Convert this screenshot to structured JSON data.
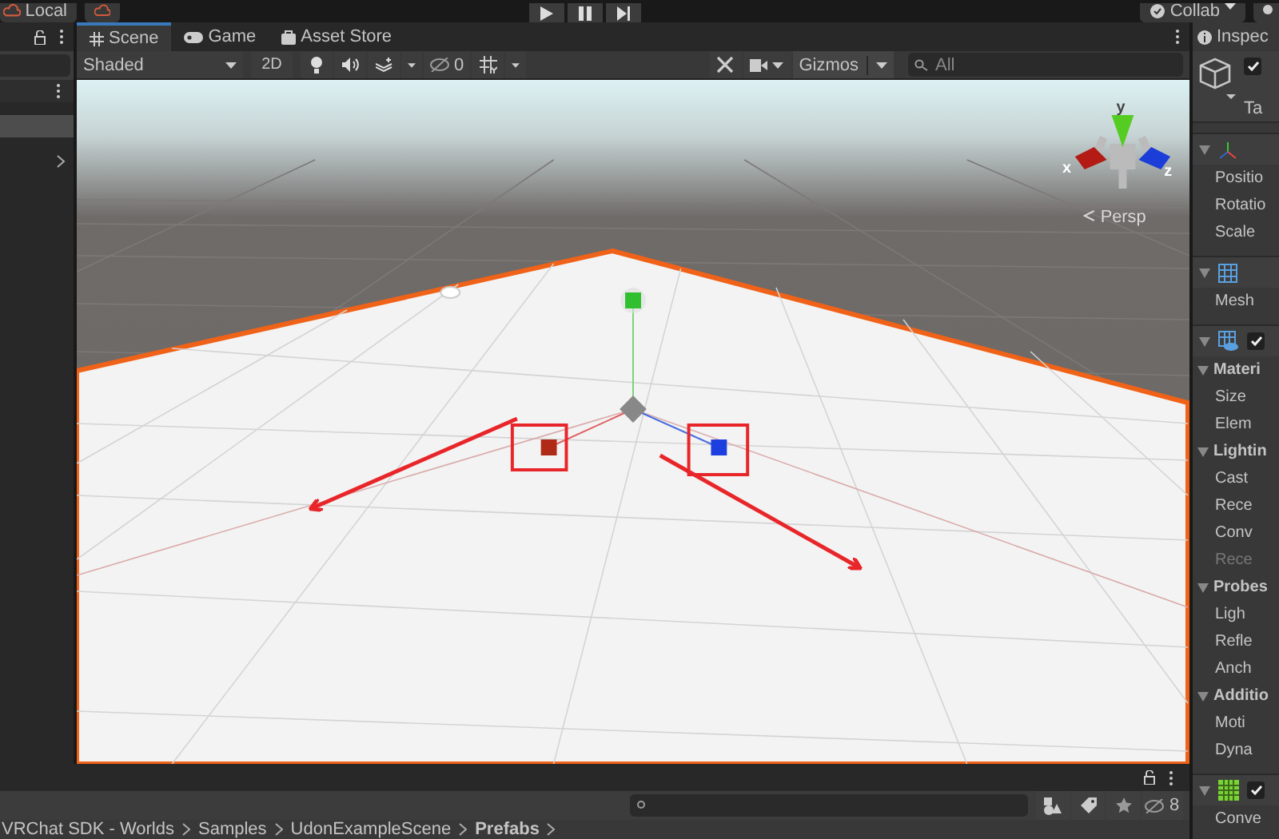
{
  "toolbar": {
    "account": "Local",
    "collab": "Collab"
  },
  "hierarchy": {
    "selected_row": {
      "selected": true
    },
    "collapsed_row": {
      "expanded": false
    }
  },
  "scene_tabs": [
    {
      "label": "Scene",
      "selected": true,
      "kind": "scene"
    },
    {
      "label": "Game",
      "selected": false,
      "kind": "game"
    },
    {
      "label": "Asset Store",
      "selected": false,
      "kind": "store"
    }
  ],
  "scene_toolbar": {
    "shading": "Shaded",
    "mode_2d": "2D",
    "hidden_count": "0",
    "gizmos": "Gizmos",
    "search_placeholder": "All"
  },
  "scene": {
    "view_label": "Persp",
    "axes": {
      "y": "y",
      "x": "x",
      "z": "z"
    }
  },
  "inspector": {
    "tab": "Inspec",
    "active": true,
    "tag_label": "Ta",
    "components": [
      {
        "kind": "transform",
        "expanded": true,
        "rows": [
          {
            "kind": "field",
            "label": "Positio",
            "disabled": false
          },
          {
            "kind": "field",
            "label": "Rotatio",
            "disabled": false
          },
          {
            "kind": "field",
            "label": "Scale",
            "disabled": false
          }
        ]
      },
      {
        "kind": "mesh_filter",
        "expanded": true,
        "rows": [
          {
            "kind": "field",
            "label": "Mesh",
            "disabled": false
          }
        ]
      },
      {
        "kind": "mesh_renderer",
        "expanded": true,
        "enabled": true,
        "rows": [
          {
            "kind": "section",
            "label": "Materi",
            "expanded": true
          },
          {
            "kind": "field",
            "label": "Size",
            "disabled": false
          },
          {
            "kind": "field",
            "label": "Elem",
            "disabled": false
          },
          {
            "kind": "section",
            "label": "Lightin",
            "expanded": true
          },
          {
            "kind": "field",
            "label": "Cast",
            "disabled": false
          },
          {
            "kind": "field",
            "label": "Rece",
            "disabled": false
          },
          {
            "kind": "field",
            "label": "Conv",
            "disabled": false
          },
          {
            "kind": "field",
            "label": "Rece",
            "disabled": true
          },
          {
            "kind": "section",
            "label": "Probes",
            "expanded": true
          },
          {
            "kind": "field",
            "label": "Ligh",
            "disabled": false
          },
          {
            "kind": "field",
            "label": "Refle",
            "disabled": false
          },
          {
            "kind": "field",
            "label": "Anch",
            "disabled": false
          },
          {
            "kind": "section",
            "label": "Additio",
            "expanded": true
          },
          {
            "kind": "field",
            "label": "Moti",
            "disabled": false
          },
          {
            "kind": "field",
            "label": "Dyna",
            "disabled": false
          }
        ]
      },
      {
        "kind": "mesh_collider",
        "expanded": true,
        "enabled": true,
        "rows": [
          {
            "kind": "field",
            "label": "Conve",
            "disabled": false
          }
        ]
      }
    ]
  },
  "project": {
    "hidden_count": "8",
    "breadcrumb": [
      {
        "label": "VRChat SDK - Worlds",
        "current": false
      },
      {
        "label": "Samples",
        "current": false
      },
      {
        "label": "UdonExampleScene",
        "current": false
      },
      {
        "label": "Prefabs",
        "current": true
      }
    ]
  }
}
